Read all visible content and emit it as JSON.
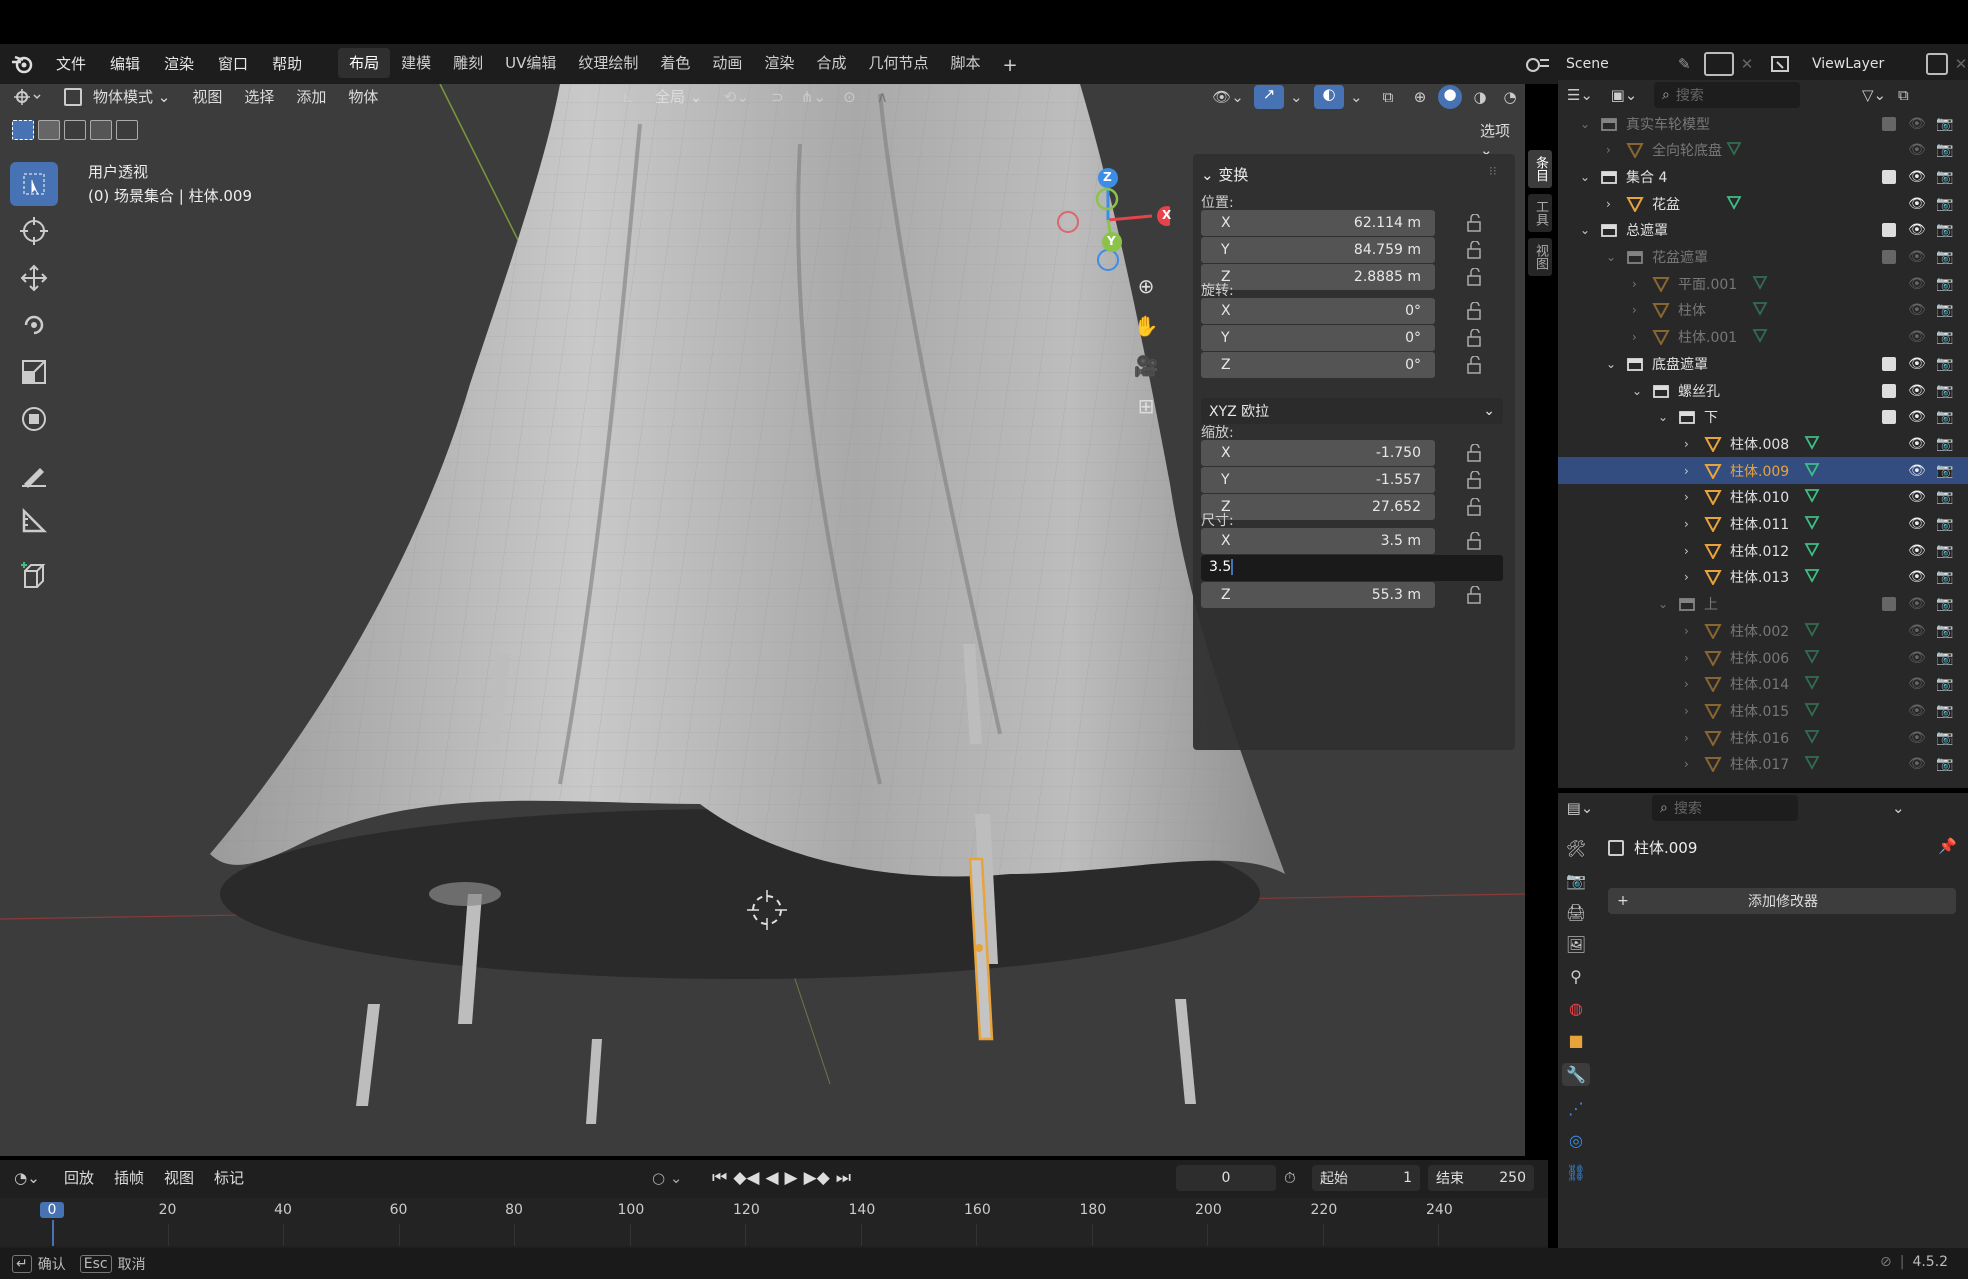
{
  "menu": {
    "items": [
      "文件",
      "编辑",
      "渲染",
      "窗口",
      "帮助"
    ],
    "workspaces": [
      "布局",
      "建模",
      "雕刻",
      "UV编辑",
      "纹理绘制",
      "着色",
      "动画",
      "渲染",
      "合成",
      "几何节点",
      "脚本"
    ],
    "active_workspace": 0,
    "add_tab": "+",
    "scene": "Scene",
    "view_layer": "ViewLayer"
  },
  "viewport": {
    "mode": "物体模式",
    "menus": [
      "视图",
      "选择",
      "添加",
      "物体"
    ],
    "transform_orientation": "全局",
    "options": "选项",
    "view_name": "用户透视",
    "collection_info": "(0) 场景集合 | 柱体.009",
    "gizmo": {
      "x": "X",
      "y": "Y",
      "z": "Z"
    }
  },
  "npanel": {
    "section": "变换",
    "location_label": "位置:",
    "location": [
      {
        "axis": "X",
        "value": "62.114 m"
      },
      {
        "axis": "Y",
        "value": "84.759 m"
      },
      {
        "axis": "Z",
        "value": "2.8885 m"
      }
    ],
    "rotation_label": "旋转:",
    "rotation": [
      {
        "axis": "X",
        "value": "0°"
      },
      {
        "axis": "Y",
        "value": "0°"
      },
      {
        "axis": "Z",
        "value": "0°"
      }
    ],
    "rotation_mode": "XYZ 欧拉",
    "scale_label": "缩放:",
    "scale": [
      {
        "axis": "X",
        "value": "-1.750"
      },
      {
        "axis": "Y",
        "value": "-1.557"
      },
      {
        "axis": "Z",
        "value": "27.652"
      }
    ],
    "dimensions_label": "尺寸:",
    "dimensions": [
      {
        "axis": "X",
        "value": "3.5 m"
      },
      {
        "axis": "Y",
        "value": ""
      },
      {
        "axis": "Z",
        "value": "55.3 m"
      }
    ],
    "editing_value": "3.5",
    "side_tabs": [
      "条目",
      "工具",
      "视图"
    ]
  },
  "outliner": {
    "search_placeholder": "搜索",
    "rows": [
      {
        "label": "真实车轮模型",
        "indent": 0,
        "type": "collection",
        "dim": true
      },
      {
        "label": "全向轮底盘",
        "indent": 1,
        "type": "mesh",
        "dim": true
      },
      {
        "label": "集合 4",
        "indent": 0,
        "type": "collection",
        "dim": false
      },
      {
        "label": "花盆",
        "indent": 1,
        "type": "mesh",
        "dim": false
      },
      {
        "label": "总遮罩",
        "indent": 0,
        "type": "collection",
        "dim": false
      },
      {
        "label": "花盆遮罩",
        "indent": 1,
        "type": "collection",
        "dim": true
      },
      {
        "label": "平面.001",
        "indent": 2,
        "type": "mesh",
        "dim": true
      },
      {
        "label": "柱体",
        "indent": 2,
        "type": "mesh",
        "dim": true
      },
      {
        "label": "柱体.001",
        "indent": 2,
        "type": "mesh",
        "dim": true
      },
      {
        "label": "底盘遮罩",
        "indent": 1,
        "type": "collection",
        "dim": false
      },
      {
        "label": "螺丝孔",
        "indent": 2,
        "type": "collection",
        "dim": false
      },
      {
        "label": "下",
        "indent": 3,
        "type": "collection",
        "dim": false
      },
      {
        "label": "柱体.008",
        "indent": 4,
        "type": "mesh",
        "dim": false
      },
      {
        "label": "柱体.009",
        "indent": 4,
        "type": "mesh",
        "dim": false,
        "selected": true
      },
      {
        "label": "柱体.010",
        "indent": 4,
        "type": "mesh",
        "dim": false
      },
      {
        "label": "柱体.011",
        "indent": 4,
        "type": "mesh",
        "dim": false
      },
      {
        "label": "柱体.012",
        "indent": 4,
        "type": "mesh",
        "dim": false
      },
      {
        "label": "柱体.013",
        "indent": 4,
        "type": "mesh",
        "dim": false
      },
      {
        "label": "上",
        "indent": 3,
        "type": "collection",
        "dim": true
      },
      {
        "label": "柱体.002",
        "indent": 4,
        "type": "mesh",
        "dim": true
      },
      {
        "label": "柱体.006",
        "indent": 4,
        "type": "mesh",
        "dim": true
      },
      {
        "label": "柱体.014",
        "indent": 4,
        "type": "mesh",
        "dim": true
      },
      {
        "label": "柱体.015",
        "indent": 4,
        "type": "mesh",
        "dim": true
      },
      {
        "label": "柱体.016",
        "indent": 4,
        "type": "mesh",
        "dim": true
      },
      {
        "label": "柱体.017",
        "indent": 4,
        "type": "mesh",
        "dim": true
      }
    ]
  },
  "properties": {
    "search_placeholder": "搜索",
    "object_name": "柱体.009",
    "add_modifier": "添加修改器"
  },
  "timeline": {
    "menus": [
      "回放",
      "插帧",
      "视图",
      "标记"
    ],
    "current_frame": "0",
    "start_label": "起始",
    "start": "1",
    "end_label": "结束",
    "end": "250",
    "ruler": [
      "0",
      "20",
      "40",
      "60",
      "80",
      "100",
      "120",
      "140",
      "160",
      "180",
      "200",
      "220",
      "240"
    ]
  },
  "status": {
    "confirm": "确认",
    "esc": "Esc",
    "cancel": "取消",
    "version": "4.5.2"
  },
  "colors": {
    "accent": "#4772b3",
    "selected_row": "#334d80",
    "orange": "#e8a33a",
    "green": "#3dbf86",
    "x": "#e8424a",
    "y": "#8bc34a",
    "z": "#3b8de8"
  }
}
